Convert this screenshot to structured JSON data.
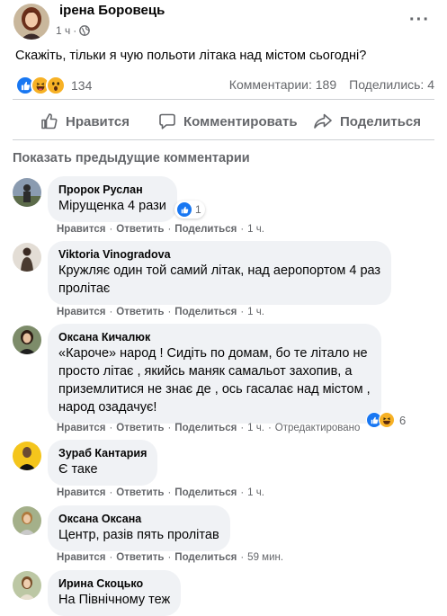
{
  "post": {
    "author": "ірена Боровець",
    "time": "1 ч",
    "text": "Скажіть, тільки я чую польоти літака над містом сьогодні?",
    "reactions": {
      "icons": [
        "like-icon",
        "haha-icon",
        "wow-icon"
      ],
      "count": "134"
    },
    "comments_count": "Комментарии: 189",
    "shares_count": "Поделились: 4"
  },
  "actions": {
    "like": "Нравится",
    "comment": "Комментировать",
    "share": "Поделиться"
  },
  "previous_comments": "Показать предыдущие комментарии",
  "comment_actions": {
    "like": "Нравится",
    "reply": "Ответить",
    "share": "Поделиться",
    "edited": "Отредактировано"
  },
  "comments": [
    {
      "name": "Пророк Руслан",
      "lines": [
        "Мірущенка 4 рази"
      ],
      "time": "1 ч.",
      "reaction_count": "1"
    },
    {
      "name": "Viktoria Vinogradova",
      "lines": [
        "Кружляє один той самий літак, над аеропортом 4 раз",
        "пролітає"
      ],
      "time": "1 ч."
    },
    {
      "name": "Оксана Кичалюк",
      "lines": [
        "«Кароче» народ ! Сидіть по домам, бо те літало не",
        "просто літає , якийсь маняк самальот захопив, а",
        "приземлитися не знає де , ось гасалає над містом ,",
        "народ озадачує!"
      ],
      "time": "1 ч.",
      "reaction_count": "6"
    },
    {
      "name": "Зураб Кантария",
      "lines": [
        "Є таке"
      ],
      "time": "1 ч."
    },
    {
      "name": "Оксана Оксана",
      "lines": [
        "Центр, разів пять пролітав"
      ],
      "time": "59 мин."
    },
    {
      "name": "Ирина Скоцько",
      "lines": [
        "На Північному теж"
      ]
    }
  ],
  "colors": {
    "like_blue": "#1877f2",
    "haha_yellow": "#f7b125",
    "text_secondary": "#65676b",
    "bubble_bg": "#f0f2f5"
  }
}
